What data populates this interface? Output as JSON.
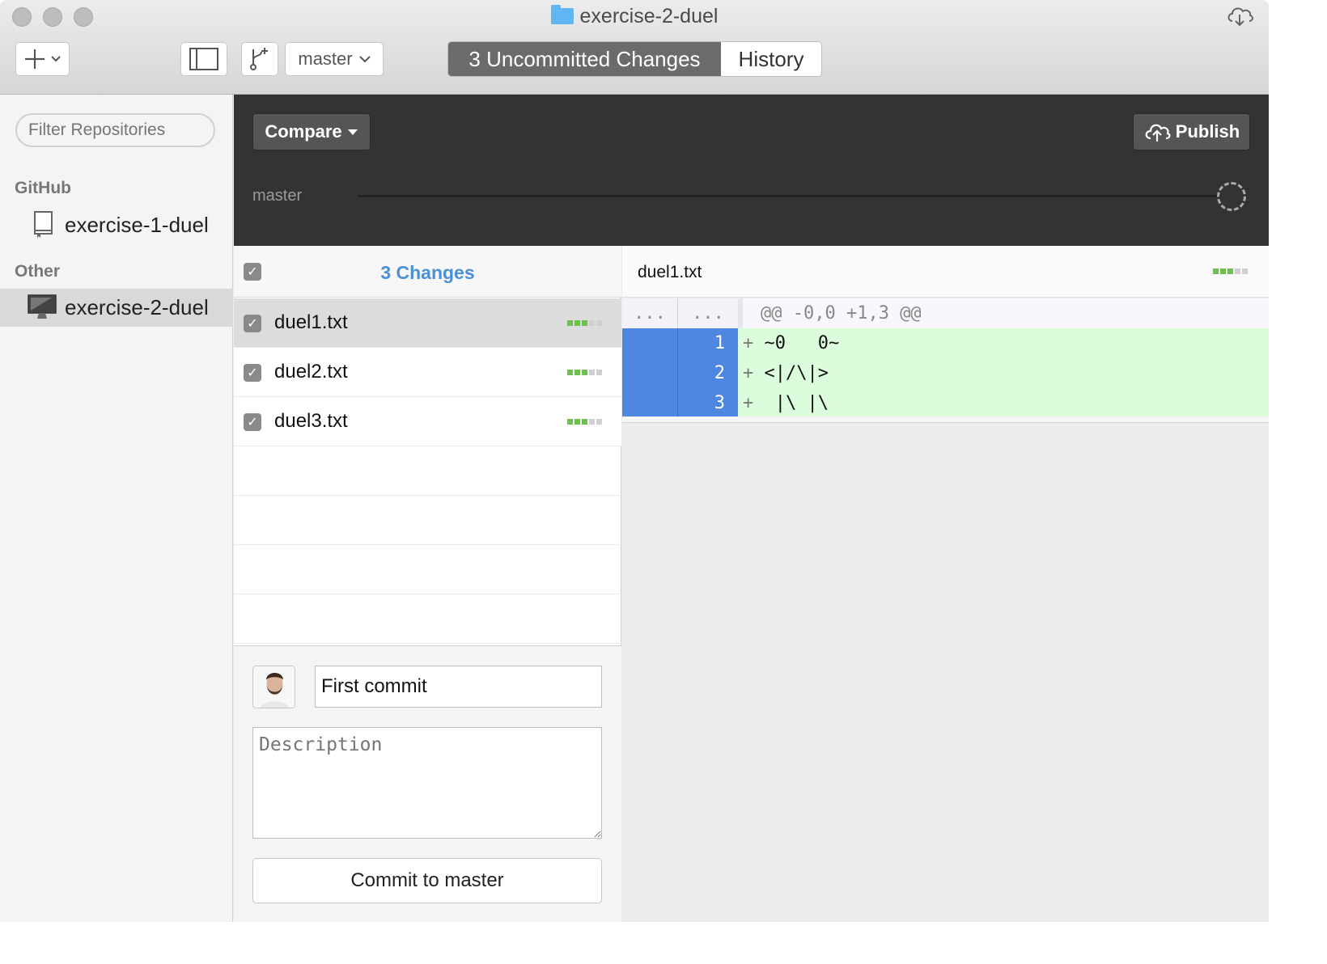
{
  "window": {
    "title": "exercise-2-duel"
  },
  "toolbar": {
    "branch": "master",
    "tabs": [
      {
        "label": "3 Uncommitted Changes",
        "active": true
      },
      {
        "label": "History",
        "active": false
      }
    ]
  },
  "sidebar": {
    "filter_placeholder": "Filter Repositories",
    "sections": [
      {
        "title": "GitHub",
        "items": [
          {
            "label": "exercise-1-duel",
            "icon": "repo-book-icon",
            "selected": false
          }
        ]
      },
      {
        "title": "Other",
        "items": [
          {
            "label": "exercise-2-duel",
            "icon": "computer-icon",
            "selected": true
          }
        ]
      }
    ]
  },
  "compare_bar": {
    "compare_label": "Compare",
    "publish_label": "Publish",
    "branch_label": "master"
  },
  "changes": {
    "title": "3 Changes",
    "files": [
      {
        "name": "duel1.txt",
        "checked": true,
        "selected": true,
        "stat": [
          "add",
          "add",
          "add",
          "none",
          "none"
        ]
      },
      {
        "name": "duel2.txt",
        "checked": true,
        "selected": false,
        "stat": [
          "add",
          "add",
          "add",
          "none",
          "none"
        ]
      },
      {
        "name": "duel3.txt",
        "checked": true,
        "selected": false,
        "stat": [
          "add",
          "add",
          "add",
          "none",
          "none"
        ]
      }
    ]
  },
  "commit": {
    "summary": "First commit",
    "description_placeholder": "Description",
    "button_label": "Commit to master"
  },
  "diff": {
    "file": "duel1.txt",
    "hunk_header": "@@ -0,0 +1,3 @@",
    "hunk_gutter": "...",
    "lines": [
      {
        "new_num": "1",
        "sign": "+",
        "text": "~0   0~"
      },
      {
        "new_num": "2",
        "sign": "+",
        "text": "<|/\\|>"
      },
      {
        "new_num": "3",
        "sign": "+",
        "text": " |\\ |\\"
      }
    ]
  },
  "colors": {
    "accent": "#4a90d9",
    "added_bg": "#dcfddc",
    "gutter_selected": "#4e86e0",
    "stat_add": "#6cc24a",
    "stat_none": "#d0d0d0"
  }
}
